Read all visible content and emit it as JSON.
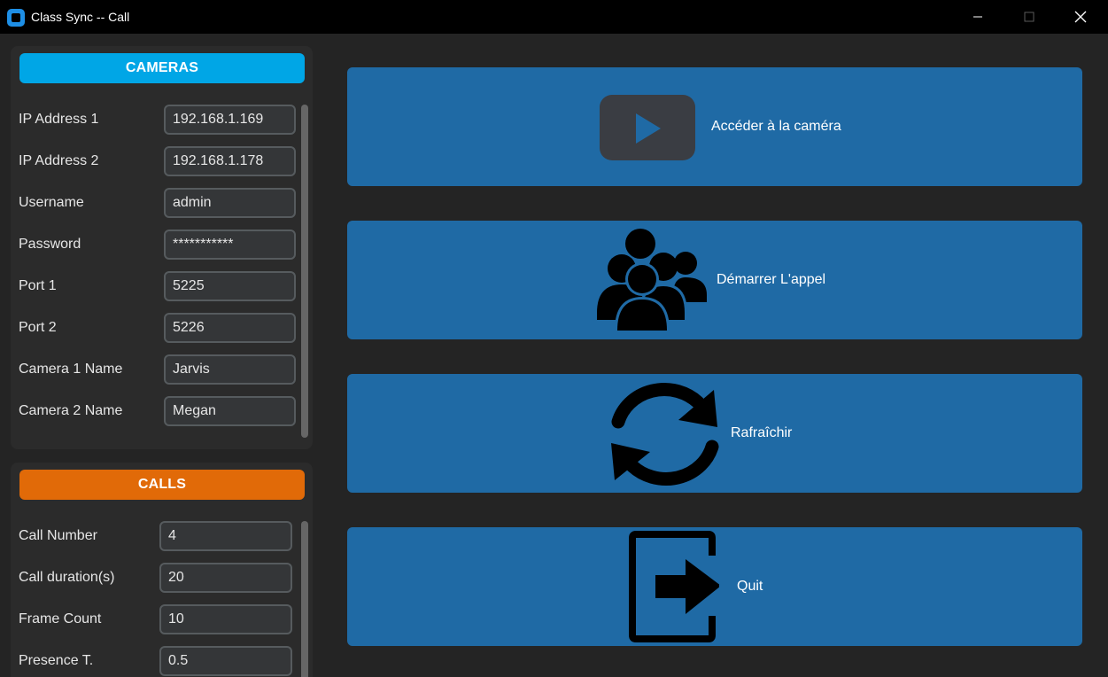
{
  "window": {
    "title": "Class Sync -- Call",
    "minimize_glyph": "—",
    "maximize_glyph": "☐",
    "close_glyph": "✕"
  },
  "cameras": {
    "header": "CAMERAS",
    "fields": [
      {
        "label": "IP Address 1",
        "value": "192.168.1.169"
      },
      {
        "label": "IP Address 2",
        "value": "192.168.1.178"
      },
      {
        "label": "Username",
        "value": "admin"
      },
      {
        "label": "Password",
        "value": "***********"
      },
      {
        "label": "Port 1",
        "value": "5225"
      },
      {
        "label": "Port 2",
        "value": "5226"
      },
      {
        "label": "Camera 1 Name",
        "value": "Jarvis"
      },
      {
        "label": "Camera 2 Name",
        "value": "Megan"
      }
    ]
  },
  "calls": {
    "header": "CALLS",
    "fields": [
      {
        "label": "Call Number",
        "value": "4"
      },
      {
        "label": "Call duration(s)",
        "value": "20"
      },
      {
        "label": "Frame Count",
        "value": "10"
      },
      {
        "label": "Presence T.",
        "value": "0.5"
      }
    ]
  },
  "actions": [
    {
      "label": "Accéder à la caméra",
      "icon": "video-play-icon"
    },
    {
      "label": "Démarrer L'appel",
      "icon": "group-icon"
    },
    {
      "label": "Rafraîchir",
      "icon": "refresh-icon"
    },
    {
      "label": "Quit",
      "icon": "exit-icon"
    }
  ],
  "colors": {
    "cameras_header": "#00a6e6",
    "calls_header": "#e16a08",
    "action_button": "#1f6aa5",
    "background": "#242424",
    "panel": "#2b2b2b"
  }
}
